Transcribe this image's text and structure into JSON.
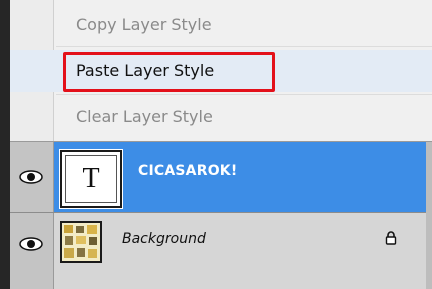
{
  "context_menu": {
    "items": [
      {
        "label": "Copy Layer Style",
        "state": "disabled"
      },
      {
        "label": "Paste Layer Style",
        "state": "enabled",
        "highlighted": true
      },
      {
        "label": "Clear Layer Style",
        "state": "disabled"
      }
    ]
  },
  "layers": [
    {
      "name": "CICASAROK!",
      "type": "text",
      "thumbnail_glyph": "T",
      "selected": true,
      "visible": true,
      "icon": "eye-icon"
    },
    {
      "name": "Background",
      "type": "image",
      "selected": false,
      "visible": true,
      "locked": true,
      "icon": "eye-icon",
      "lock_icon": "lock-icon"
    }
  ],
  "colors": {
    "selected_row": "#3d8de6",
    "highlight_outline": "#e3101a",
    "menu_background": "#f0f0f0",
    "disabled_text": "#8a8a8a"
  }
}
